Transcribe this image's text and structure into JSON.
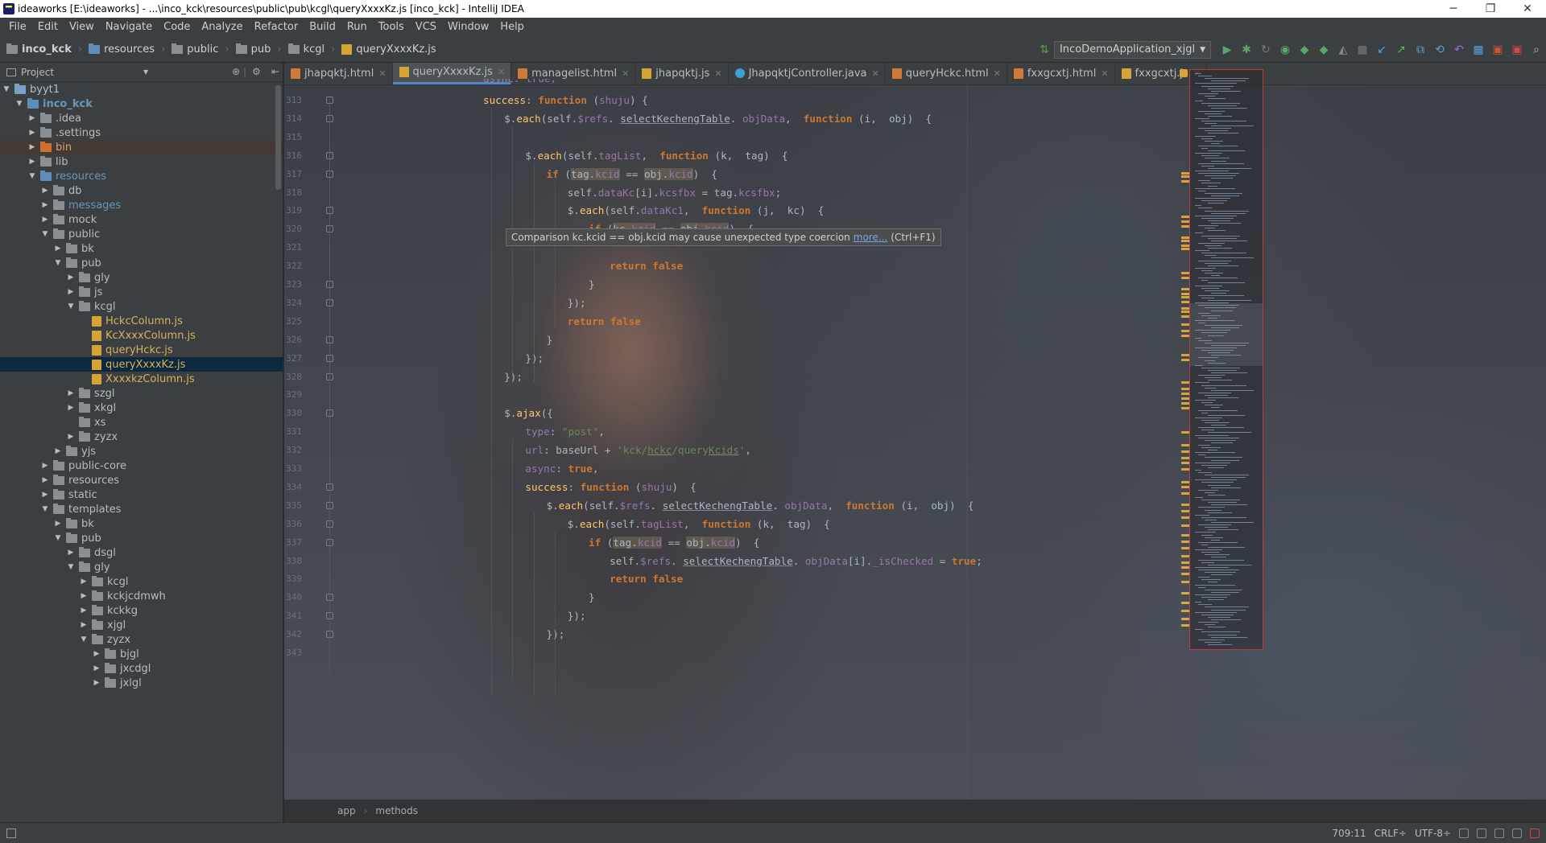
{
  "window": {
    "title": "ideaworks [E:\\ideaworks] - ...\\inco_kck\\resources\\public\\pub\\kcgl\\queryXxxxKz.js [inco_kck] - IntelliJ IDEA",
    "minimize": "─",
    "maximize": "❐",
    "close": "✕"
  },
  "menu": [
    "File",
    "Edit",
    "View",
    "Navigate",
    "Code",
    "Analyze",
    "Refactor",
    "Build",
    "Run",
    "Tools",
    "VCS",
    "Window",
    "Help"
  ],
  "breadcrumb": [
    "inco_kck",
    "resources",
    "public",
    "pub",
    "kcgl",
    "queryXxxxKz.js"
  ],
  "run_config": "IncoDemoApplication_xjgl",
  "project_panel": {
    "title": "Project",
    "tree": [
      {
        "label": "byyt1",
        "depth": 0,
        "arrow": "down",
        "icon": "module",
        "style": ""
      },
      {
        "label": "inco_kck",
        "depth": 1,
        "arrow": "down",
        "icon": "blue",
        "style": "bold"
      },
      {
        "label": ".idea",
        "depth": 2,
        "arrow": "right",
        "icon": "grey",
        "style": ""
      },
      {
        "label": ".settings",
        "depth": 2,
        "arrow": "right",
        "icon": "grey",
        "style": ""
      },
      {
        "label": "bin",
        "depth": 2,
        "arrow": "right",
        "icon": "orange",
        "style": "orange",
        "hl": true
      },
      {
        "label": "lib",
        "depth": 2,
        "arrow": "right",
        "icon": "grey",
        "style": ""
      },
      {
        "label": "resources",
        "depth": 2,
        "arrow": "down",
        "icon": "blue",
        "style": "blue"
      },
      {
        "label": "db",
        "depth": 3,
        "arrow": "right",
        "icon": "grey",
        "style": ""
      },
      {
        "label": "messages",
        "depth": 3,
        "arrow": "right",
        "icon": "grey",
        "style": "blue"
      },
      {
        "label": "mock",
        "depth": 3,
        "arrow": "right",
        "icon": "grey",
        "style": ""
      },
      {
        "label": "public",
        "depth": 3,
        "arrow": "down",
        "icon": "grey",
        "style": ""
      },
      {
        "label": "bk",
        "depth": 4,
        "arrow": "right",
        "icon": "grey",
        "style": ""
      },
      {
        "label": "pub",
        "depth": 4,
        "arrow": "down",
        "icon": "grey",
        "style": ""
      },
      {
        "label": "gly",
        "depth": 5,
        "arrow": "right",
        "icon": "grey",
        "style": ""
      },
      {
        "label": "js",
        "depth": 5,
        "arrow": "right",
        "icon": "grey",
        "style": ""
      },
      {
        "label": "kcgl",
        "depth": 5,
        "arrow": "down",
        "icon": "grey",
        "style": ""
      },
      {
        "label": "HckcColumn.js",
        "depth": 6,
        "arrow": "",
        "icon": "js",
        "style": "yellow"
      },
      {
        "label": "KcXxxxColumn.js",
        "depth": 6,
        "arrow": "",
        "icon": "js",
        "style": "yellow"
      },
      {
        "label": "queryHckc.js",
        "depth": 6,
        "arrow": "",
        "icon": "js",
        "style": "yellow"
      },
      {
        "label": "queryXxxxKz.js",
        "depth": 6,
        "arrow": "",
        "icon": "js",
        "style": "yellow",
        "selected": true
      },
      {
        "label": "XxxxkzColumn.js",
        "depth": 6,
        "arrow": "",
        "icon": "js",
        "style": "yellow"
      },
      {
        "label": "szgl",
        "depth": 5,
        "arrow": "right",
        "icon": "grey",
        "style": ""
      },
      {
        "label": "xkgl",
        "depth": 5,
        "arrow": "right",
        "icon": "grey",
        "style": ""
      },
      {
        "label": "xs",
        "depth": 5,
        "arrow": "",
        "icon": "grey",
        "style": ""
      },
      {
        "label": "zyzx",
        "depth": 5,
        "arrow": "right",
        "icon": "grey",
        "style": ""
      },
      {
        "label": "yjs",
        "depth": 4,
        "arrow": "right",
        "icon": "grey",
        "style": ""
      },
      {
        "label": "public-core",
        "depth": 3,
        "arrow": "right",
        "icon": "grey",
        "style": ""
      },
      {
        "label": "resources",
        "depth": 3,
        "arrow": "right",
        "icon": "grey",
        "style": ""
      },
      {
        "label": "static",
        "depth": 3,
        "arrow": "right",
        "icon": "grey",
        "style": ""
      },
      {
        "label": "templates",
        "depth": 3,
        "arrow": "down",
        "icon": "grey",
        "style": ""
      },
      {
        "label": "bk",
        "depth": 4,
        "arrow": "right",
        "icon": "grey",
        "style": ""
      },
      {
        "label": "pub",
        "depth": 4,
        "arrow": "down",
        "icon": "grey",
        "style": ""
      },
      {
        "label": "dsgl",
        "depth": 5,
        "arrow": "right",
        "icon": "grey",
        "style": ""
      },
      {
        "label": "gly",
        "depth": 5,
        "arrow": "down",
        "icon": "grey",
        "style": ""
      },
      {
        "label": "kcgl",
        "depth": 6,
        "arrow": "right",
        "icon": "grey",
        "style": ""
      },
      {
        "label": "kckjcdmwh",
        "depth": 6,
        "arrow": "right",
        "icon": "grey",
        "style": ""
      },
      {
        "label": "kckkg",
        "depth": 6,
        "arrow": "right",
        "icon": "grey",
        "style": ""
      },
      {
        "label": "xjgl",
        "depth": 6,
        "arrow": "right",
        "icon": "grey",
        "style": ""
      },
      {
        "label": "zyzx",
        "depth": 6,
        "arrow": "down",
        "icon": "grey",
        "style": ""
      },
      {
        "label": "bjgl",
        "depth": 7,
        "arrow": "right",
        "icon": "grey",
        "style": ""
      },
      {
        "label": "jxcdgl",
        "depth": 7,
        "arrow": "right",
        "icon": "grey",
        "style": ""
      },
      {
        "label": "jxlgl",
        "depth": 7,
        "arrow": "right",
        "icon": "grey",
        "style": ""
      }
    ]
  },
  "tabs": [
    {
      "label": "jhapqktj.html",
      "type": "html",
      "active": false
    },
    {
      "label": "queryXxxxKz.js",
      "type": "js",
      "active": true
    },
    {
      "label": "managelist.html",
      "type": "html",
      "active": false
    },
    {
      "label": "jhapqktj.js",
      "type": "js",
      "active": false
    },
    {
      "label": "JhapqktjController.java",
      "type": "java",
      "active": false
    },
    {
      "label": "queryHckc.html",
      "type": "html",
      "active": false
    },
    {
      "label": "fxxgcxtj.html",
      "type": "html",
      "active": false
    },
    {
      "label": "fxxgcxtj.js",
      "type": "js",
      "active": false
    }
  ],
  "code_lines": [
    {
      "n": "313",
      "i": 0,
      "t": [
        [
          "kw-",
          ""
        ],
        [
          "fn",
          "success"
        ],
        [
          "nm",
          ": "
        ],
        [
          "kw",
          "function"
        ],
        [
          "nm",
          " ("
        ],
        [
          "pr",
          "shuju"
        ],
        [
          "nm",
          ") {"
        ]
      ]
    },
    {
      "n": "314",
      "i": 1,
      "t": [
        [
          "nm",
          "$."
        ],
        [
          "fn",
          "each"
        ],
        [
          "nm",
          "(self."
        ],
        [
          "pr",
          "$refs"
        ],
        [
          "nm",
          ". "
        ],
        [
          "un",
          "selectKechengTable"
        ],
        [
          "nm",
          ". "
        ],
        [
          "pr",
          "objData"
        ],
        [
          "nm",
          ",  "
        ],
        [
          "kw",
          "function"
        ],
        [
          "nm",
          " (i,  obj)  {"
        ]
      ]
    },
    {
      "n": "315",
      "i": 0,
      "t": []
    },
    {
      "n": "316",
      "i": 2,
      "t": [
        [
          "nm",
          "$."
        ],
        [
          "fn",
          "each"
        ],
        [
          "nm",
          "(self."
        ],
        [
          "pr",
          "tagList"
        ],
        [
          "nm",
          ",  "
        ],
        [
          "kw",
          "function"
        ],
        [
          "nm",
          " (k,  tag)  {"
        ]
      ]
    },
    {
      "n": "317",
      "i": 3,
      "t": [
        [
          "kw",
          "if"
        ],
        [
          "nm",
          " ("
        ],
        [
          "mk",
          "tag."
        ],
        [
          "mkp",
          "kcid"
        ],
        [
          "nm",
          " == "
        ],
        [
          "mk",
          "obj."
        ],
        [
          "mkp",
          "kcid"
        ],
        [
          "nm",
          ")  {"
        ]
      ]
    },
    {
      "n": "318",
      "i": 4,
      "t": [
        [
          "nm",
          "self."
        ],
        [
          "pr",
          "dataKc"
        ],
        [
          "nm",
          "[i]."
        ],
        [
          "pr",
          "kcsfbx"
        ],
        [
          "nm",
          " = tag."
        ],
        [
          "pr",
          "kcsfbx"
        ],
        [
          "nm",
          ";"
        ]
      ]
    },
    {
      "n": "319",
      "i": 4,
      "t": [
        [
          "nm",
          "$."
        ],
        [
          "fn",
          "each"
        ],
        [
          "nm",
          "(self."
        ],
        [
          "pr",
          "dataKc1"
        ],
        [
          "nm",
          ",  "
        ],
        [
          "kw",
          "function"
        ],
        [
          "nm",
          " (j,  kc)  {"
        ]
      ]
    },
    {
      "n": "320",
      "i": 5,
      "t": [
        [
          "kw",
          "if"
        ],
        [
          "nm",
          " ("
        ],
        [
          "mk",
          "kc."
        ],
        [
          "mkp",
          "kcid"
        ],
        [
          "nm",
          " == "
        ],
        [
          "mk",
          "obj."
        ],
        [
          "mkp",
          "kcid"
        ],
        [
          "nm",
          ")  {"
        ]
      ]
    },
    {
      "n": "321",
      "i": 0,
      "t": []
    },
    {
      "n": "322",
      "i": 6,
      "t": [
        [
          "kw",
          "return false"
        ]
      ]
    },
    {
      "n": "323",
      "i": 5,
      "t": [
        [
          "nm",
          "}"
        ]
      ]
    },
    {
      "n": "324",
      "i": 4,
      "t": [
        [
          "nm",
          "});"
        ]
      ]
    },
    {
      "n": "325",
      "i": 4,
      "t": [
        [
          "kw",
          "return false"
        ]
      ]
    },
    {
      "n": "326",
      "i": 3,
      "t": [
        [
          "nm",
          "}"
        ]
      ]
    },
    {
      "n": "327",
      "i": 2,
      "t": [
        [
          "nm",
          "});"
        ]
      ]
    },
    {
      "n": "328",
      "i": 1,
      "t": [
        [
          "nm",
          "});"
        ]
      ]
    },
    {
      "n": "329",
      "i": 0,
      "t": []
    },
    {
      "n": "330",
      "i": 1,
      "t": [
        [
          "nm",
          "$."
        ],
        [
          "fn",
          "ajax"
        ],
        [
          "nm",
          "({"
        ]
      ]
    },
    {
      "n": "331",
      "i": 2,
      "t": [
        [
          "pr",
          "type"
        ],
        [
          "nm",
          ": "
        ],
        [
          "st",
          "\"post\""
        ],
        [
          "nm",
          ","
        ]
      ]
    },
    {
      "n": "332",
      "i": 2,
      "t": [
        [
          "pr",
          "url"
        ],
        [
          "nm",
          ": baseUrl + "
        ],
        [
          "st",
          "'kck/"
        ],
        [
          "stu",
          "hckc"
        ],
        [
          "st",
          "/query"
        ],
        [
          "stu",
          "Kcids"
        ],
        [
          "st",
          "'"
        ],
        [
          "nm",
          ","
        ]
      ]
    },
    {
      "n": "333",
      "i": 2,
      "t": [
        [
          "pr",
          "async"
        ],
        [
          "nm",
          ": "
        ],
        [
          "kw",
          "true"
        ],
        [
          "nm",
          ","
        ]
      ]
    },
    {
      "n": "334",
      "i": 2,
      "t": [
        [
          "fn",
          "success"
        ],
        [
          "nm",
          ": "
        ],
        [
          "kw",
          "function"
        ],
        [
          "nm",
          " ("
        ],
        [
          "pr",
          "shuju"
        ],
        [
          "nm",
          ")  {"
        ]
      ]
    },
    {
      "n": "335",
      "i": 3,
      "t": [
        [
          "nm",
          "$."
        ],
        [
          "fn",
          "each"
        ],
        [
          "nm",
          "(self."
        ],
        [
          "pr",
          "$refs"
        ],
        [
          "nm",
          ". "
        ],
        [
          "un",
          "selectKechengTable"
        ],
        [
          "nm",
          ". "
        ],
        [
          "pr",
          "objData"
        ],
        [
          "nm",
          ",  "
        ],
        [
          "kw",
          "function"
        ],
        [
          "nm",
          " (i,  obj)  {"
        ]
      ]
    },
    {
      "n": "336",
      "i": 4,
      "t": [
        [
          "nm",
          "$."
        ],
        [
          "fn",
          "each"
        ],
        [
          "nm",
          "(self."
        ],
        [
          "pr",
          "tagList"
        ],
        [
          "nm",
          ",  "
        ],
        [
          "kw",
          "function"
        ],
        [
          "nm",
          " (k,  tag)  {"
        ]
      ]
    },
    {
      "n": "337",
      "i": 5,
      "t": [
        [
          "kw",
          "if"
        ],
        [
          "nm",
          " ("
        ],
        [
          "mk",
          "tag."
        ],
        [
          "mkp",
          "kcid"
        ],
        [
          "nm",
          " == "
        ],
        [
          "mk",
          "obj."
        ],
        [
          "mkp",
          "kcid"
        ],
        [
          "nm",
          ")  {"
        ]
      ]
    },
    {
      "n": "338",
      "i": 6,
      "t": [
        [
          "nm",
          "self."
        ],
        [
          "pr",
          "$refs"
        ],
        [
          "nm",
          ". "
        ],
        [
          "un",
          "selectKechengTable"
        ],
        [
          "nm",
          ". "
        ],
        [
          "pr",
          "objData"
        ],
        [
          "nm",
          "[i]."
        ],
        [
          "pr",
          "_isChecked"
        ],
        [
          "nm",
          " = "
        ],
        [
          "kw",
          "true"
        ],
        [
          "nm",
          ";"
        ]
      ]
    },
    {
      "n": "339",
      "i": 6,
      "t": [
        [
          "kw",
          "return false"
        ]
      ]
    },
    {
      "n": "340",
      "i": 5,
      "t": [
        [
          "nm",
          "}"
        ]
      ]
    },
    {
      "n": "341",
      "i": 4,
      "t": [
        [
          "nm",
          "});"
        ]
      ]
    },
    {
      "n": "342",
      "i": 3,
      "t": [
        [
          "nm",
          "});"
        ]
      ]
    },
    {
      "n": "343",
      "i": 0,
      "t": []
    }
  ],
  "partial_top_line": "async: true,",
  "tooltip": {
    "text": "Comparison kc.kcid == obj.kcid may cause unexpected type coercion",
    "link": "more...",
    "shortcut": "(Ctrl+F1)"
  },
  "editor_breadcrumb": [
    "app",
    "methods"
  ],
  "status": {
    "position": "709:11",
    "line_sep": "CRLF÷",
    "encoding": "UTF-8÷"
  }
}
